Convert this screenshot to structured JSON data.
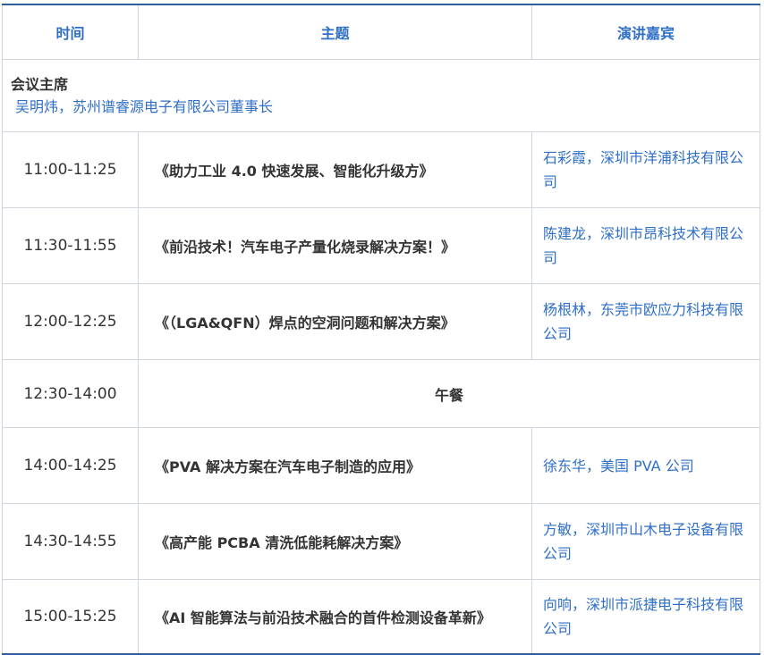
{
  "header": {
    "time": "时间",
    "topic": "主题",
    "speaker": "演讲嘉宾"
  },
  "chair": {
    "title": "会议主席",
    "name": "吴明炜，苏州谱睿源电子有限公司董事长"
  },
  "sessions": [
    {
      "time": "11:00-11:25",
      "topic": "《助力工业 4.0 快速发展、智能化升级方》",
      "speaker": "石彩霞，深圳市洋浦科技有限公司"
    },
    {
      "time": "11:30-11:55",
      "topic": "《前沿技术！汽车电子产量化烧录解决方案！》",
      "speaker": "陈建龙，深圳市昂科技术有限公司"
    },
    {
      "time": "12:00-12:25",
      "topic": "《（LGA&QFN）焊点的空洞问题和解决方案》",
      "speaker": "杨根林，东莞市欧应力科技有限公司"
    },
    {
      "time": "12:30-14:00",
      "topic": "午餐",
      "speaker": ""
    },
    {
      "time": "14:00-14:25",
      "topic": "《PVA 解决方案在汽车电子制造的应用》",
      "speaker": "徐东华，美国 PVA 公司"
    },
    {
      "time": "14:30-14:55",
      "topic": "《高产能 PCBA 清洗低能耗解决方案》",
      "speaker": "方敏，深圳市山木电子设备有限公司"
    },
    {
      "time": "15:00-15:25",
      "topic": "《AI 智能算法与前沿技术融合的首件检测设备革新》",
      "speaker": "向响，深圳市派捷电子科技有限公司"
    }
  ]
}
